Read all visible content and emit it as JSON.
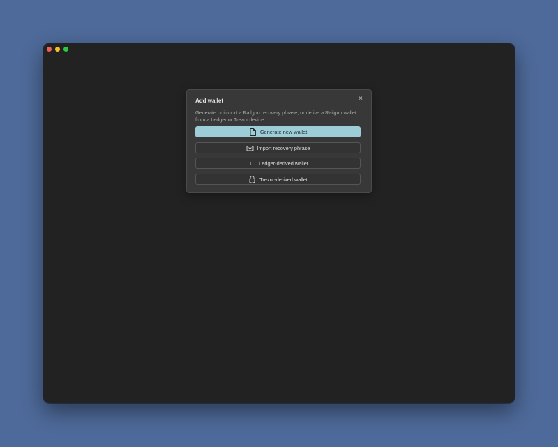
{
  "dialog": {
    "title": "Add wallet",
    "close_symbol": "×",
    "description": "Generate or import a Railgun recovery phrase, or derive a Railgun wallet from a Ledger or Trezor device.",
    "options": [
      {
        "label": "Generate new wallet",
        "icon": "document-icon",
        "primary": true
      },
      {
        "label": "Import recovery phrase",
        "icon": "import-icon",
        "primary": false
      },
      {
        "label": "Ledger-derived wallet",
        "icon": "ledger-icon",
        "primary": false
      },
      {
        "label": "Trezor-derived wallet",
        "icon": "trezor-icon",
        "primary": false
      }
    ]
  },
  "colors": {
    "desktop": "#4e6a9a",
    "window": "#222222",
    "dialog": "#383838",
    "primary_button": "#9dcdd6"
  }
}
